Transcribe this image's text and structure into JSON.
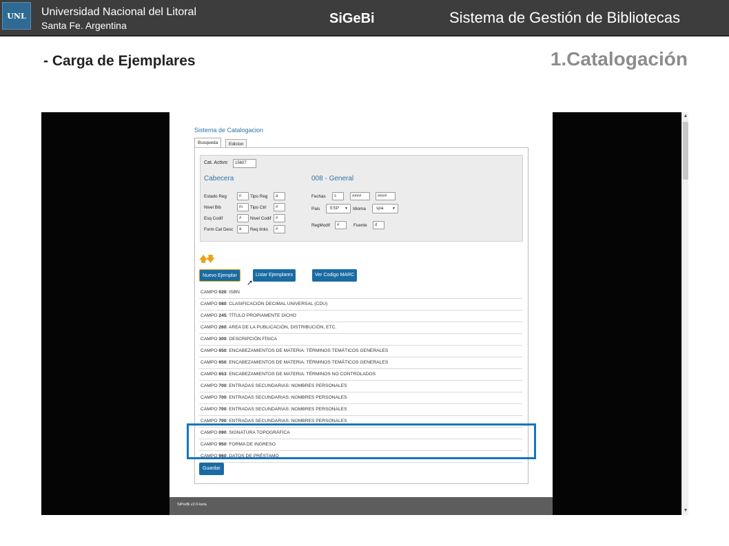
{
  "header": {
    "logo_text": "UNL",
    "university": "Universidad Nacional del Litoral",
    "city": "Santa Fe. Argentina",
    "app_short": "SiGeBi",
    "app_long": "Sistema de Gestión de Bibliotecas"
  },
  "slide": {
    "section_title": "- Carga de Ejemplares",
    "step_title": "1.Catalogación"
  },
  "screen": {
    "system_title": "Sistema de Catalogacion",
    "tabs": [
      "Busqueda",
      "Edicion"
    ],
    "cat_activo_label": "Cat. Activo:",
    "cat_activo_value": "15607",
    "cabecera_title": "Cabecera",
    "general_title": "008 - General",
    "cabecera_fields": [
      {
        "label": "Estado Reg",
        "value": "n"
      },
      {
        "label": "Tipo Reg",
        "value": "a"
      },
      {
        "label": "Nivel Bib",
        "value": "m"
      },
      {
        "label": "Tipo Ctrl",
        "value": "#"
      },
      {
        "label": "Esq Codif",
        "value": "#"
      },
      {
        "label": "Nivel Codif",
        "value": "#"
      },
      {
        "label": "Form Cat Desc",
        "value": "a"
      },
      {
        "label": "Req links",
        "value": "#"
      }
    ],
    "general_fields": {
      "fechas_label": "Fechas",
      "fechas_values": [
        "s",
        "####",
        "####"
      ],
      "pais_label": "Pais",
      "pais_value": "ESP",
      "idioma_label": "Idioma",
      "idioma_value": "spa",
      "regmodif_label": "RegModif",
      "regmodif_value": "#",
      "fuente_label": "Fuente",
      "fuente_value": "d"
    },
    "arrows": "🡅🡇",
    "buttons": {
      "nuevo": "Nuevo Ejemplar",
      "listar": "Listar Ejemplares",
      "vercodigo": "Ver Codigo MARC",
      "guardar": "Guardar"
    },
    "campos": [
      {
        "prefix": "CAMPO ",
        "code": "020",
        "desc": ": ISBN"
      },
      {
        "prefix": "CAMPO ",
        "code": "080",
        "desc": ": CLASIFICACIÓN DECIMAL UNIVERSAL (CDU)"
      },
      {
        "prefix": "CAMPO ",
        "code": "245",
        "desc": ": TÍTULO PROPIAMENTE DICHO"
      },
      {
        "prefix": "CAMPO ",
        "code": "260",
        "desc": ": AREA DE LA PUBLICACIÓN, DISTRIBUCIÓN, ETC."
      },
      {
        "prefix": "CAMPO ",
        "code": "300",
        "desc": ": DESCRIPCIÓN FÍSICA"
      },
      {
        "prefix": "CAMPO ",
        "code": "650",
        "desc": ": ENCABEZAMIENTOS DE MATERIA: TÉRMINOS TEMÁTICOS GENERALES"
      },
      {
        "prefix": "CAMPO ",
        "code": "650",
        "desc": ": ENCABEZAMIENTOS DE MATERIA: TÉRMINOS TEMÁTICOS GENERALES"
      },
      {
        "prefix": "CAMPO ",
        "code": "653",
        "desc": ": ENCABEZAMIENTOS DE MATERIA: TÉRMINOS NO CONTROLADOS"
      },
      {
        "prefix": "CAMPO ",
        "code": "700",
        "desc": ": ENTRADAS SECUNDARIAS: NOMBRES PERSONALES"
      },
      {
        "prefix": "CAMPO ",
        "code": "700",
        "desc": ": ENTRADAS SECUNDARIAS: NOMBRES PERSONALES"
      },
      {
        "prefix": "CAMPO ",
        "code": "700",
        "desc": ": ENTRADAS SECUNDARIAS: NOMBRES PERSONALES"
      },
      {
        "prefix": "CAMPO ",
        "code": "700",
        "desc": ": ENTRADAS SECUNDARIAS: NOMBRES PERSONALES"
      },
      {
        "prefix": "CAMPO ",
        "code": "090",
        "desc": ": SIGNATURA TOPOGRÁFICA"
      },
      {
        "prefix": "CAMPO ",
        "code": "950",
        "desc": ": FORMA DE INGRESO"
      },
      {
        "prefix": "CAMPO ",
        "code": "960",
        "desc": ": DATOS DE PRÉSTAMO"
      }
    ],
    "footer": "SiPreBi v2.0-beta"
  },
  "colors": {
    "header_bg": "#3d3d3d",
    "accent_blue": "#1a6ba3",
    "highlight": "#1475bd",
    "arrow_orange": "#e8a317"
  }
}
